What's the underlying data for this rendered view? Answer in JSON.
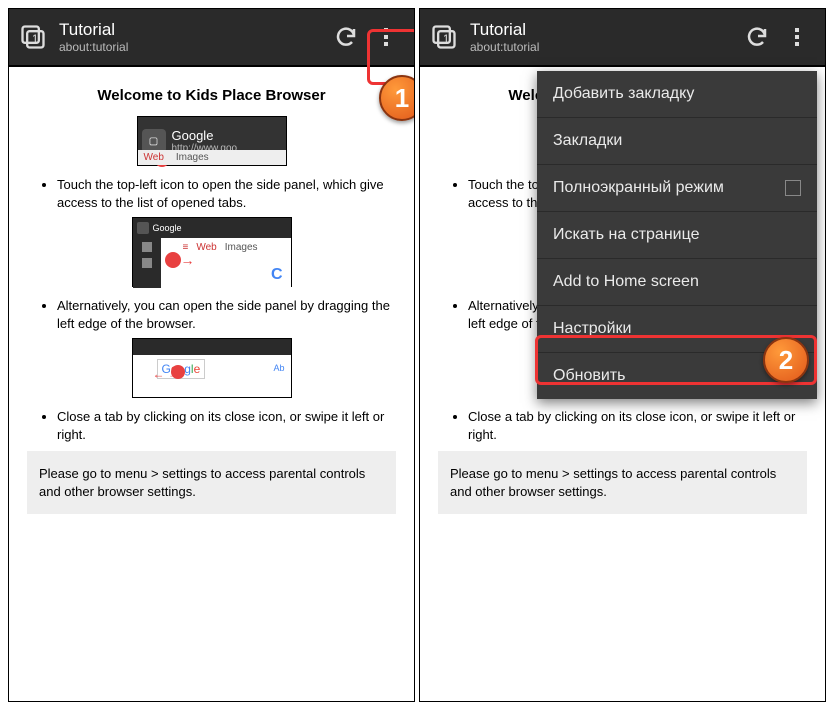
{
  "header": {
    "title": "Tutorial",
    "subtitle": "about:tutorial"
  },
  "page": {
    "heading": "Welcome to Kids Place Browser",
    "bullets": [
      "Touch the top-left icon to open the side panel, which give access to the list of opened tabs.",
      "Alternatively, you can open the side panel by dragging the left edge of the browser.",
      "Close a tab by clicking on its close icon, or swipe it left or right."
    ],
    "notice": "Please go to menu > settings to access parental controls and other browser settings."
  },
  "illus": {
    "google_title": "Google",
    "google_url": "http://www.goo",
    "web": "Web",
    "images": "Images",
    "google_small": "Google"
  },
  "menu": {
    "items": [
      "Добавить закладку",
      "Закладки",
      "Полноэкранный режим",
      "Искать на странице",
      "Add to Home screen",
      "Настройки",
      "Обновить"
    ]
  },
  "badges": {
    "one": "1",
    "two": "2"
  }
}
